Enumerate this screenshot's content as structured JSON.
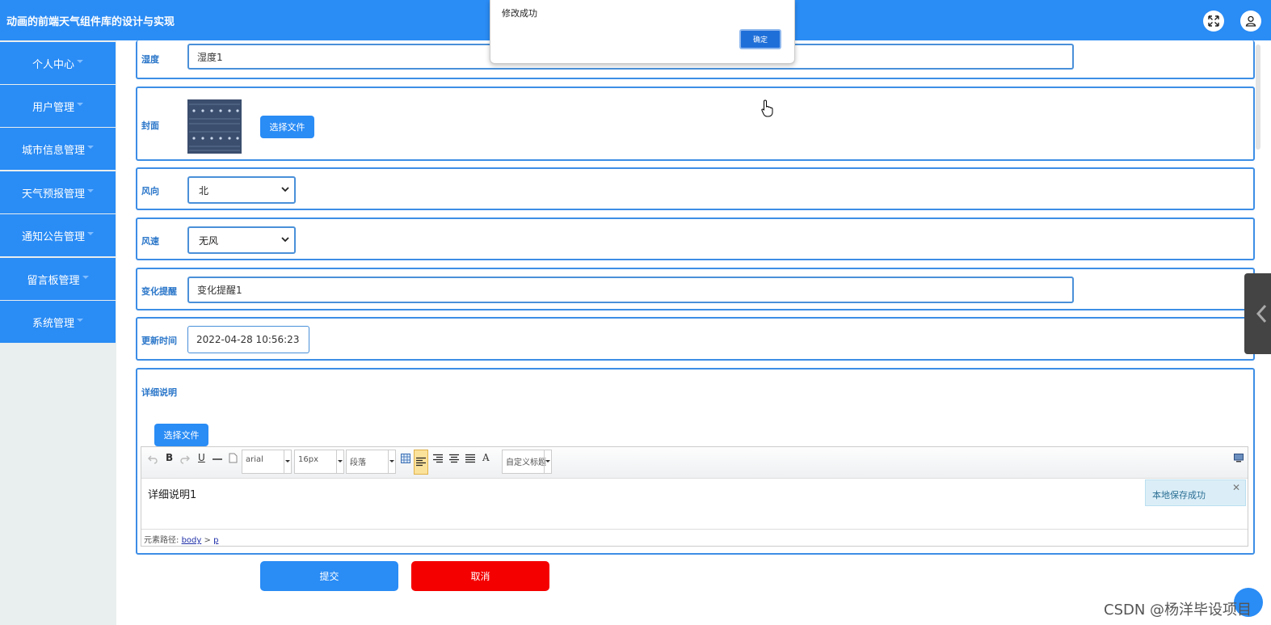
{
  "header": {
    "title": "动画的前端天气组件库的设计与实现"
  },
  "sidebar": {
    "items": [
      {
        "label": "个人中心"
      },
      {
        "label": "用户管理"
      },
      {
        "label": "城市信息管理"
      },
      {
        "label": "天气预报管理"
      },
      {
        "label": "通知公告管理"
      },
      {
        "label": "留言板管理"
      },
      {
        "label": "系统管理"
      }
    ]
  },
  "form": {
    "humidity": {
      "label": "湿度",
      "value": "湿度1"
    },
    "cover": {
      "label": "封面",
      "button": "选择文件"
    },
    "wind_direction": {
      "label": "风向",
      "value": "北"
    },
    "wind_speed": {
      "label": "风速",
      "value": "无风"
    },
    "change_alert": {
      "label": "变化提醒",
      "value": "变化提醒1"
    },
    "update_time": {
      "label": "更新时间",
      "value": "2022-04-28 10:56:23"
    },
    "details": {
      "label": "详细说明",
      "file_button": "选择文件",
      "editor": {
        "toolbar": {
          "bold": "B",
          "underline": "U",
          "font_family": "arial",
          "font_size": "16px",
          "paragraph": "段落",
          "font_color": "A",
          "custom_title": "自定义标题"
        },
        "content": "详细说明1",
        "toast": "本地保存成功",
        "path_label": "元素路径:",
        "path_body": "body",
        "path_sep": ">",
        "path_p": "p"
      }
    },
    "submit": "提交",
    "cancel": "取消"
  },
  "dialog": {
    "message": "修改成功",
    "ok": "确定"
  },
  "watermark": "CSDN @杨洋毕设项目"
}
